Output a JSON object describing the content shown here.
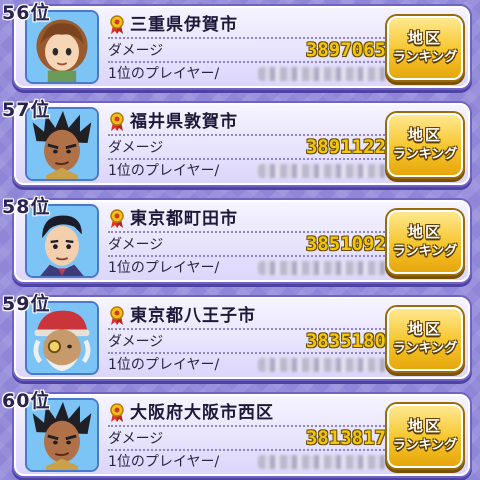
{
  "rankings": [
    {
      "rank": "56位",
      "city": "三重県伊賀市",
      "damage_label": "ダメージ",
      "damage": "3897065",
      "top_player_label": "1位のプレイヤー/",
      "avatar": "brown-hair-child-portrait"
    },
    {
      "rank": "57位",
      "city": "福井県敦賀市",
      "damage_label": "ダメージ",
      "damage": "3891122",
      "top_player_label": "1位のプレイヤー/",
      "avatar": "spiky-hair-warrior-portrait"
    },
    {
      "rank": "58位",
      "city": "東京都町田市",
      "damage_label": "ダメージ",
      "damage": "3851092",
      "top_player_label": "1位のプレイヤー/",
      "avatar": "suit-man-portrait"
    },
    {
      "rank": "59位",
      "city": "東京都八王子市",
      "damage_label": "ダメージ",
      "damage": "3835180",
      "top_player_label": "1位のプレイヤー/",
      "avatar": "red-cap-old-man-portrait"
    },
    {
      "rank": "60位",
      "city": "大阪府大阪市西区",
      "damage_label": "ダメージ",
      "damage": "3813817",
      "top_player_label": "1位のプレイヤー/",
      "avatar": "spiky-hair-warrior-portrait"
    }
  ],
  "region_button": {
    "line1": "地区",
    "line2": "ランキング"
  },
  "colors": {
    "background": "#8f86d8",
    "damage_text": "#f3c80a",
    "button": "#f6c52a",
    "card": "#eeeafd"
  }
}
